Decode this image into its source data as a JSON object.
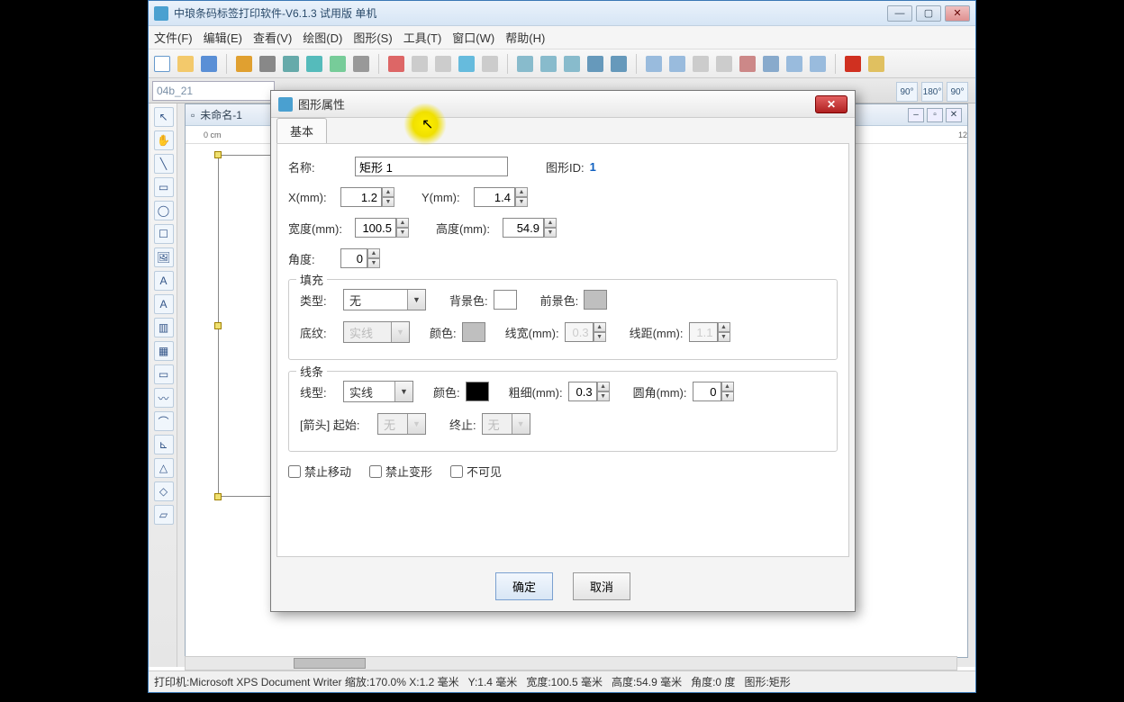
{
  "app": {
    "title": "中琅条码标签打印软件-V6.1.3 试用版 单机"
  },
  "menu": [
    "文件(F)",
    "编辑(E)",
    "查看(V)",
    "绘图(D)",
    "图形(S)",
    "工具(T)",
    "窗口(W)",
    "帮助(H)"
  ],
  "font_box": "04b_21",
  "doc": {
    "tab_title": "未命名-1",
    "ruler_start": "0 cm",
    "ruler_marks": "12"
  },
  "dialog": {
    "title": "图形属性",
    "tab": "基本",
    "name_label": "名称:",
    "name_value": "矩形 1",
    "shapeid_label": "图形ID:",
    "shapeid_value": "1",
    "x_label": "X(mm):",
    "x_value": "1.2",
    "y_label": "Y(mm):",
    "y_value": "1.4",
    "w_label": "宽度(mm):",
    "w_value": "100.5",
    "h_label": "高度(mm):",
    "h_value": "54.9",
    "angle_label": "角度:",
    "angle_value": "0",
    "fill": {
      "group": "填充",
      "type_label": "类型:",
      "type_value": "无",
      "bg_label": "背景色:",
      "fg_label": "前景色:",
      "pattern_label": "底纹:",
      "pattern_value": "实线",
      "color_label": "颜色:",
      "linew_label": "线宽(mm):",
      "linew_value": "0.3",
      "lined_label": "线距(mm):",
      "lined_value": "1.1"
    },
    "stroke": {
      "group": "线条",
      "style_label": "线型:",
      "style_value": "实线",
      "color_label": "颜色:",
      "thick_label": "粗细(mm):",
      "thick_value": "0.3",
      "corner_label": "圆角(mm):",
      "corner_value": "0",
      "arrow_label": "[箭头] 起始:",
      "arrow_start": "无",
      "end_label": "终止:",
      "arrow_end": "无"
    },
    "lock_move": "禁止移动",
    "lock_deform": "禁止变形",
    "invisible": "不可见",
    "ok": "确定",
    "cancel": "取消"
  },
  "status": {
    "printer": "打印机:Microsoft XPS Document Writer",
    "zoom": "缩放:170.0%",
    "x": "X:1.2 毫米",
    "y": "Y:1.4 毫米",
    "w": "宽度:100.5 毫米",
    "h": "高度:54.9 毫米",
    "angle": "角度:0 度",
    "shape": "图形:矩形"
  },
  "colors": {
    "bg_swatch": "#ffffff",
    "fg_swatch": "#bfbfbf",
    "pattern_color": "#bfbfbf",
    "stroke_color": "#000000"
  }
}
